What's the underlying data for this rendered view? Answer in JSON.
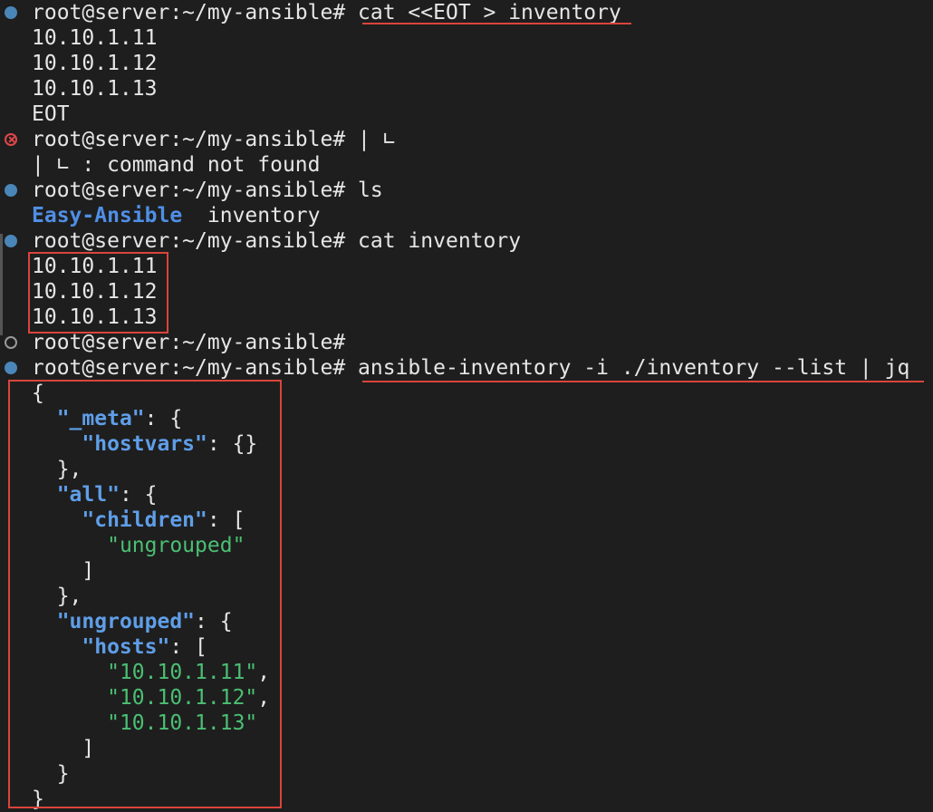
{
  "prompt": "root@server:~/my-ansible#",
  "lines": {
    "l1_cmd": "cat <<EOT > inventory",
    "l2": "10.10.1.11",
    "l3": "10.10.1.12",
    "l4": "10.10.1.13",
    "l5": "EOT",
    "l6_cmd": "| ∟",
    "l7": "| ∟ : command not found",
    "l8_cmd": "ls",
    "l9_dir": "Easy-Ansible",
    "l9_file": "inventory",
    "l10_cmd": "cat inventory",
    "l11": "10.10.1.11",
    "l12": "10.10.1.12",
    "l13": "10.10.1.13",
    "l15_cmd": "ansible-inventory -i ./inventory --list | jq"
  },
  "json": {
    "open": "{",
    "meta_key": "\"_meta\"",
    "hostvars_key": "\"hostvars\"",
    "hostvars_val": "{}",
    "all_key": "\"all\"",
    "children_key": "\"children\"",
    "child_val": "\"ungrouped\"",
    "ungrouped_key": "\"ungrouped\"",
    "hosts_key": "\"hosts\"",
    "host1": "\"10.10.1.11\"",
    "host2": "\"10.10.1.12\"",
    "host3": "\"10.10.1.13\"",
    "close": "}"
  },
  "colors": {
    "background": "#1e1e1e",
    "key": "#5f9ee8",
    "string": "#4bbf73",
    "directory": "#4f8fe6",
    "highlight": "#d9453b",
    "marker": "#4a86b8",
    "error": "#e0474b"
  }
}
